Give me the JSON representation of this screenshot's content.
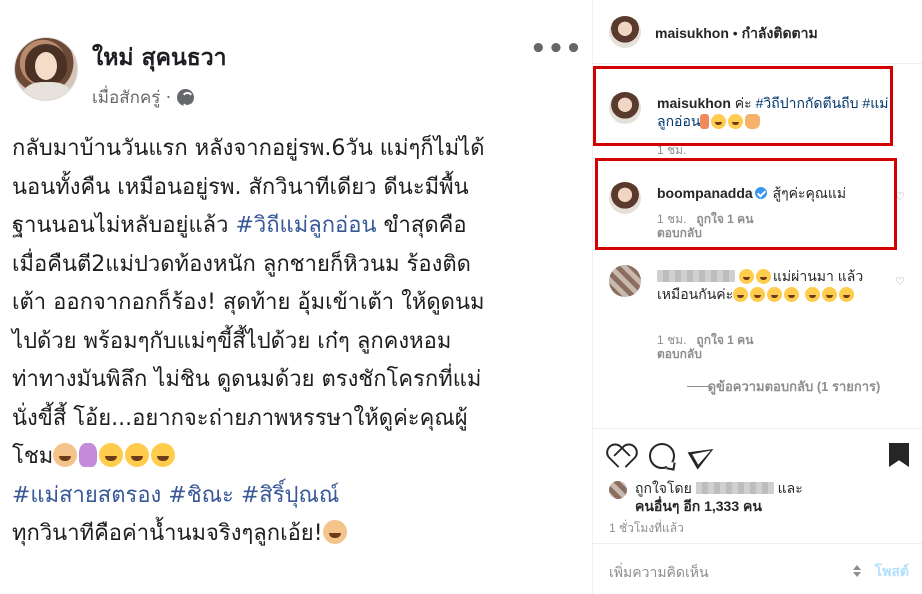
{
  "fb_post": {
    "author": "ใหม่ สุคนธวา",
    "time": "เมื่อสักครู่ ·",
    "more": "•••",
    "body": {
      "line1": "กลับมาบ้านวันแรก หลังจากอยู่รพ.6วัน แม่ๆก็ไม่ได้",
      "line2": "นอนทั้งคืน เหมือนอยู่รพ. สักวินาทีเดียว ดีนะมีพื้น",
      "line3_pre": "ฐานนอนไม่หลับอยู่แล้ว ",
      "line3_tag": "#วิถีแม่ลูกอ่อน",
      "line3_post": " ขำสุดคือ",
      "line4": "เมื่อคืนตี2แม่ปวดท้องหนัก ลูกชายก็หิวนม ร้องติด",
      "line5": "เต้า ออกจากอกก็ร้อง! สุดท้าย อุ้มเข้าเต้า ให้ดูดนม",
      "line6": "ไปด้วย พร้อมๆกับแม่ๆขี้สี้ไปด้วย เก๋ๆ ลูกคงหอม",
      "line7": "ท่าทางมันพิลึก ไม่ชิน ดูดนมด้วย ตรงชักโครกที่แม่",
      "line8": "นั่งขี้สี้ โอ้ย...อยากจะถ่ายภาพหรรษาให้ดูค่ะคุณผู้",
      "line9": "โชม",
      "hashtags": "#แม่สายสตรอง #ชิณะ #สิริ์ปุณณ์",
      "last_line": "ทุกวินาทีคือค่าน้ำนมจริงๆลูกเอ้ย!"
    }
  },
  "ig": {
    "header": {
      "username": "maisukhon",
      "separator": "•",
      "follow_status": "กำลังติดตาม"
    },
    "comments": [
      {
        "username": "maisukhon",
        "text": "ค่ะ",
        "hashtag1": "#วิถีปากกัดตีนถีบ",
        "hashtag2": "#แม่ลูกอ่อน",
        "time": "1 ชม."
      },
      {
        "username": "boompanadda",
        "text": "สู้ๆค่ะคุณแม่",
        "time": "1 ชม.",
        "likes": "ถูกใจ 1 คน",
        "reply": "ตอบกลับ"
      },
      {
        "text1": "แม่ผ่านมา",
        "text2": "แล้วเหมือนกันค่ะ",
        "time": "1 ชม.",
        "likes": "ถูกใจ 1 คน",
        "reply": "ตอบกลับ"
      }
    ],
    "view_replies": "ดูข้อความตอบกลับ (1 รายการ)",
    "likes_prefix": "ถูกใจโดย",
    "likes_and": "และ",
    "likes_others": "คนอื่นๆ อีก 1,333 คน",
    "posted_ago": "1 ชั่วโมงที่แล้ว",
    "add_comment_placeholder": "เพิ่มความคิดเห็น",
    "post_button": "โพสต์",
    "highlight_color": "#d20000",
    "link_color": "#00376b"
  }
}
